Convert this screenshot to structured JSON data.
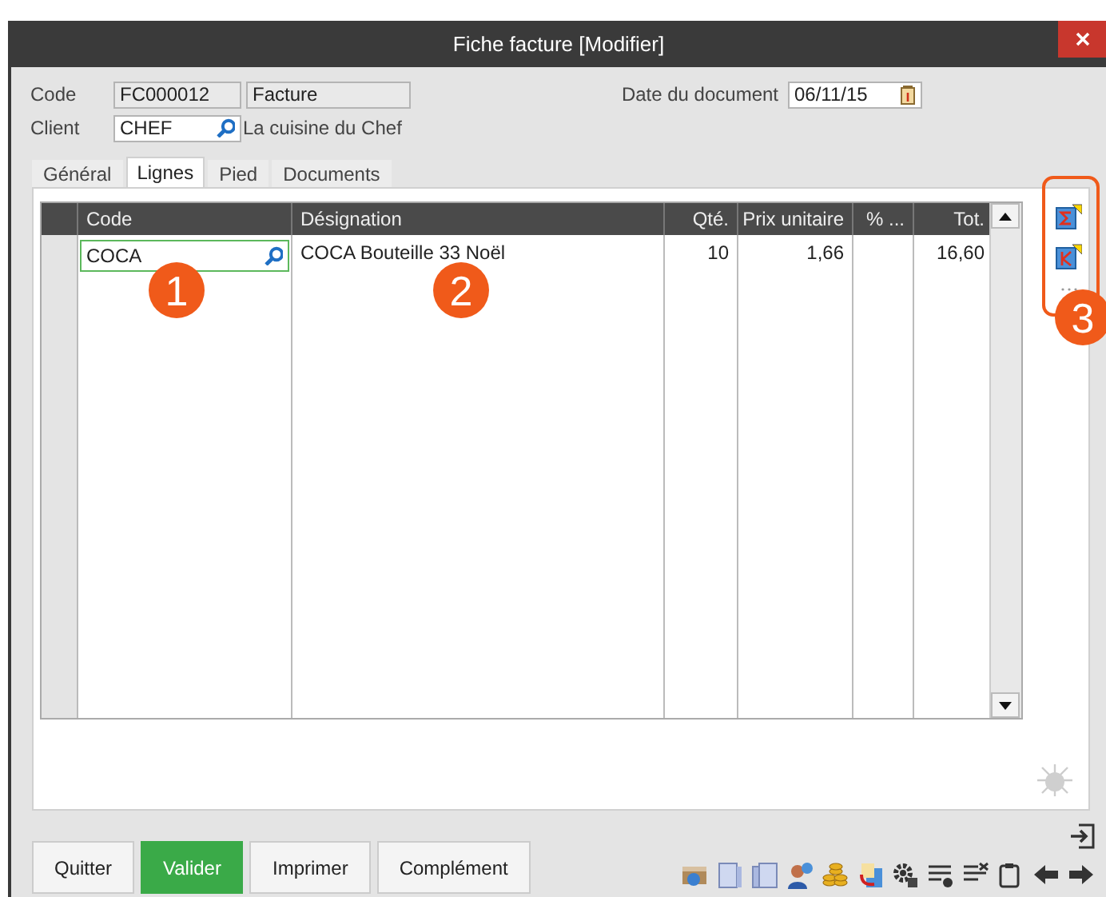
{
  "window": {
    "title": "Fiche facture [Modifier]"
  },
  "header": {
    "code_label": "Code",
    "code": "FC000012",
    "type": "Facture",
    "client_label": "Client",
    "client": "CHEF",
    "client_name": "La cuisine du Chef",
    "date_label": "Date du document",
    "date": "06/11/15"
  },
  "tabs": [
    {
      "label": "Général",
      "selected": false
    },
    {
      "label": "Lignes",
      "selected": true
    },
    {
      "label": "Pied",
      "selected": false
    },
    {
      "label": "Documents",
      "selected": false
    }
  ],
  "table": {
    "columns": [
      "Code",
      "Désignation",
      "Qté.",
      "Prix unitaire",
      "% ...",
      "Tot."
    ],
    "rows": [
      {
        "code": "COCA",
        "designation": "COCA Bouteille 33 Noël",
        "qte": "10",
        "prix_unitaire": "1,66",
        "tot": "16,60"
      }
    ]
  },
  "annotations": [
    "1",
    "2",
    "3"
  ],
  "buttons": [
    {
      "label": "Quitter",
      "primary": false
    },
    {
      "label": "Valider",
      "primary": true
    },
    {
      "label": "Imprimer",
      "primary": false
    },
    {
      "label": "Complément",
      "primary": false
    }
  ]
}
